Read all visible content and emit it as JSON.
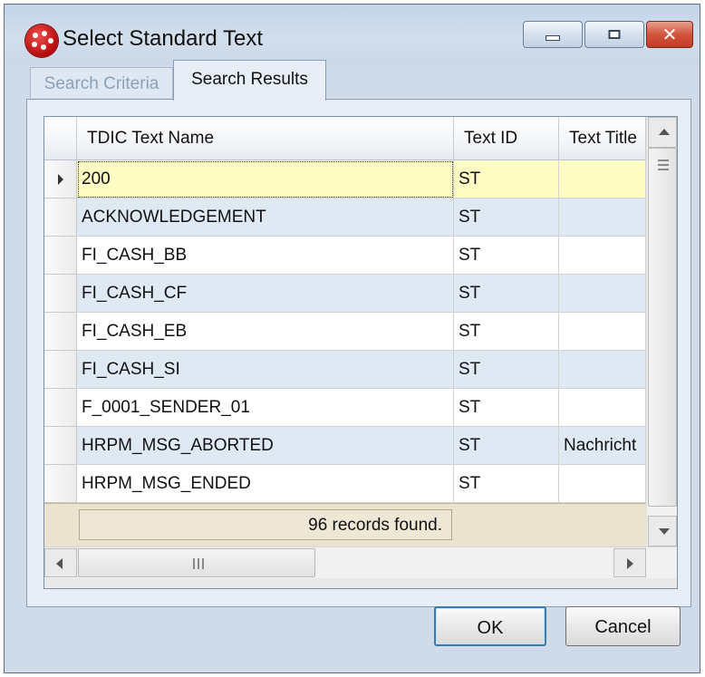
{
  "window": {
    "title": "Select Standard Text"
  },
  "tabs": [
    {
      "label": "Search Criteria",
      "active": false
    },
    {
      "label": "Search Results",
      "active": true
    }
  ],
  "grid": {
    "columns": [
      "TDIC Text Name",
      "Text ID",
      "Text Title"
    ],
    "rows": [
      {
        "name": "200",
        "text_id": "ST",
        "title": ""
      },
      {
        "name": "ACKNOWLEDGEMENT",
        "text_id": "ST",
        "title": ""
      },
      {
        "name": "FI_CASH_BB",
        "text_id": "ST",
        "title": ""
      },
      {
        "name": "FI_CASH_CF",
        "text_id": "ST",
        "title": ""
      },
      {
        "name": "FI_CASH_EB",
        "text_id": "ST",
        "title": ""
      },
      {
        "name": "FI_CASH_SI",
        "text_id": "ST",
        "title": ""
      },
      {
        "name": "F_0001_SENDER_01",
        "text_id": "ST",
        "title": ""
      },
      {
        "name": "HRPM_MSG_ABORTED",
        "text_id": "ST",
        "title": "Nachricht"
      },
      {
        "name": "HRPM_MSG_ENDED",
        "text_id": "ST",
        "title": ""
      }
    ],
    "footer": "96 records found."
  },
  "buttons": {
    "ok": "OK",
    "cancel": "Cancel"
  },
  "colors": {
    "selected_row": "#fffcc4",
    "alt_row": "#dfe9f4",
    "close_button": "#c43b24"
  },
  "icons": [
    "app-icon",
    "minimize-icon",
    "maximize-icon",
    "close-icon",
    "row-pointer-icon",
    "scroll-up-icon",
    "scroll-down-icon",
    "scroll-left-icon",
    "scroll-right-icon"
  ]
}
